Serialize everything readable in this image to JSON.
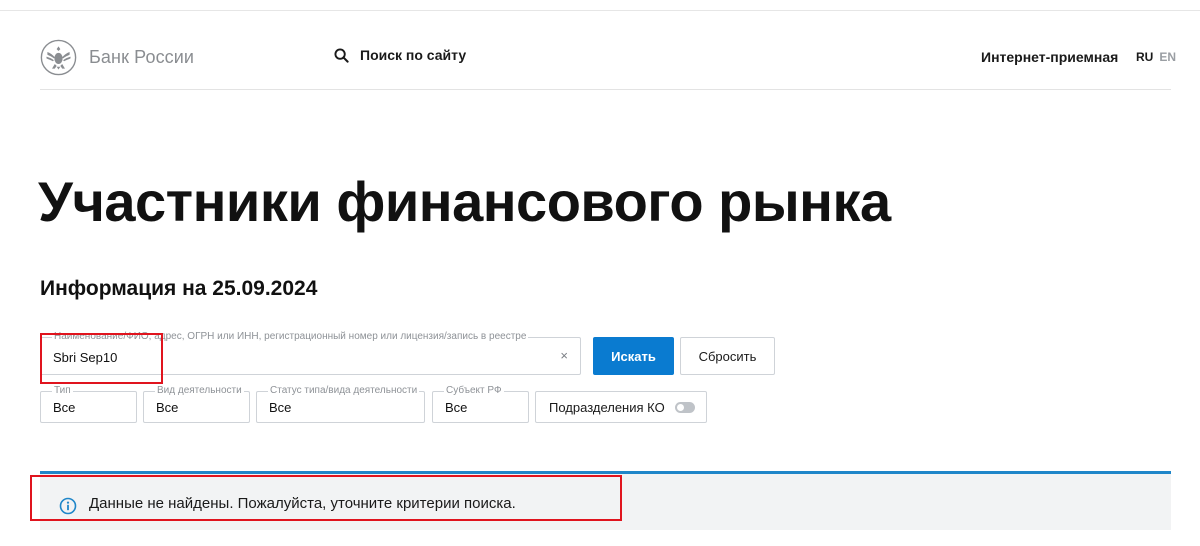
{
  "header": {
    "logo_text": "Банк России",
    "search_label": "Поиск по сайту",
    "reception_link": "Интернет-приемная",
    "lang_ru": "RU",
    "lang_en": "EN"
  },
  "page": {
    "title": "Участники финансового рынка",
    "info_date": "Информация на 25.09.2024"
  },
  "form": {
    "query_label": "Наименование/ФИО, адрес, ОГРН или ИНН, регистрационный номер или лицензия/запись в реестре",
    "query_value": "Sbri Sep10",
    "clear_icon": "×",
    "search_button": "Искать",
    "reset_button": "Сбросить",
    "filters": {
      "type_label": "Тип",
      "type_value": "Все",
      "activity_label": "Вид деятельности",
      "activity_value": "Все",
      "status_label": "Статус типа/вида деятельности",
      "status_value": "Все",
      "region_label": "Субъект РФ",
      "region_value": "Все",
      "branches_label": "Подразделения КО",
      "branches_enabled": false
    }
  },
  "notice": {
    "text": "Данные не найдены. Пожалуйста, уточните критерии поиска.",
    "icon": "info-icon"
  },
  "colors": {
    "primary": "#0a7bd0",
    "notice_border": "#1f86c9",
    "notice_bg": "#f2f3f4",
    "highlight": "#e0141e"
  }
}
